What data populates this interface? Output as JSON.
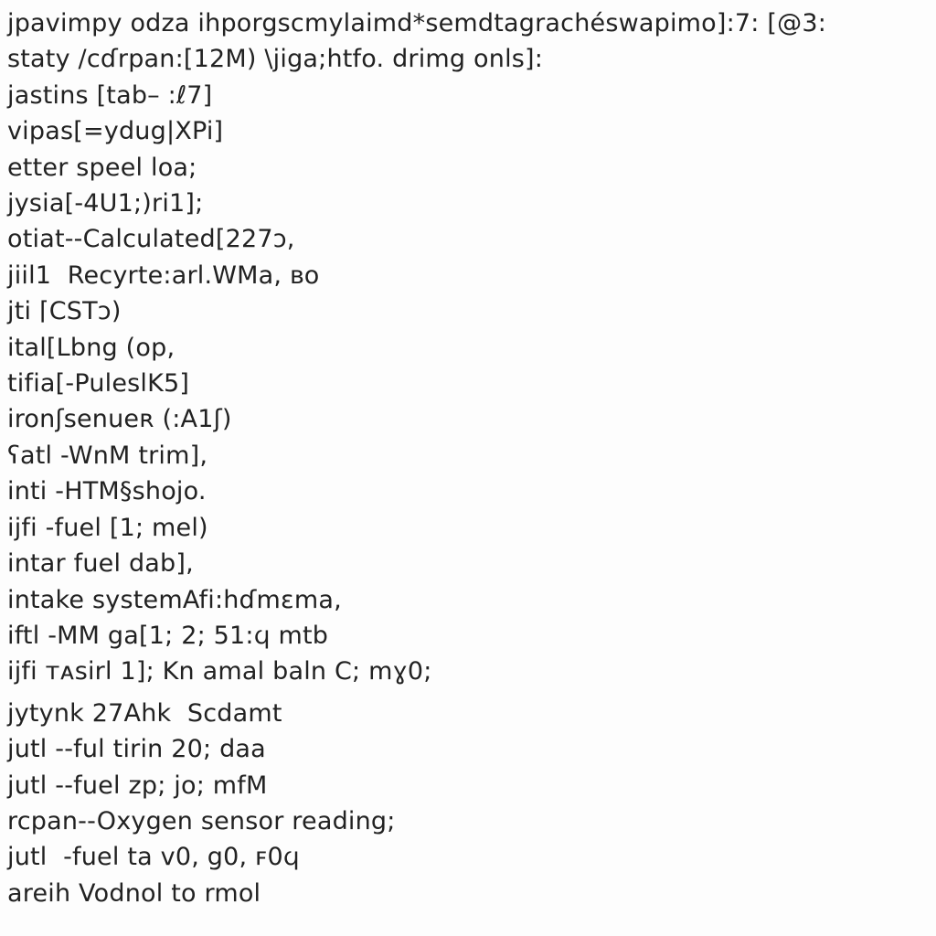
{
  "lines": [
    "jpavimpy odza ihporgscmylaimd*semdtagrachéswapimo]:7: [@3:",
    "staty /cɗrpan:[12M) \\jiga;htfo. drimg onls]:",
    "jastins [tab– :ℓ7]",
    "vipas[=ydug|XPi]",
    "etter speel loa;",
    "jysia[-4U1;)ri1];",
    "otiat--Calculated[227ɔ,",
    "jiil1  Recyrte:arl.WMa, ʙo",
    "jti ⌈CSTɔ)",
    "ital[Lbng (op,",
    "tifia[-PuleslK5]",
    "ironʃsenueʀ (:A1ʃ)",
    "ʕatl -WnM trim],",
    "inti -HTM§shojo.",
    "ijfi -fuel [1; mel)",
    "intar fuel dab],",
    "intake systemAfi:hɗmɛma,",
    "iftl -MM ga[1; 2; 51:ϥ mtb",
    "ijfi тᴀsirl 1]; Kn amal baln C; mɣ0;",
    "",
    "jytynk 27Ahk  Scdamt",
    "jutl --ful tirin 20; daa",
    "jutl --fuel zp; jo; mfM",
    "rcpan--Oxygen sensor reading;",
    "jutl  -fuel ta v0, g0, ꜰ0ϥ",
    "areih Vodnol to rmol"
  ]
}
